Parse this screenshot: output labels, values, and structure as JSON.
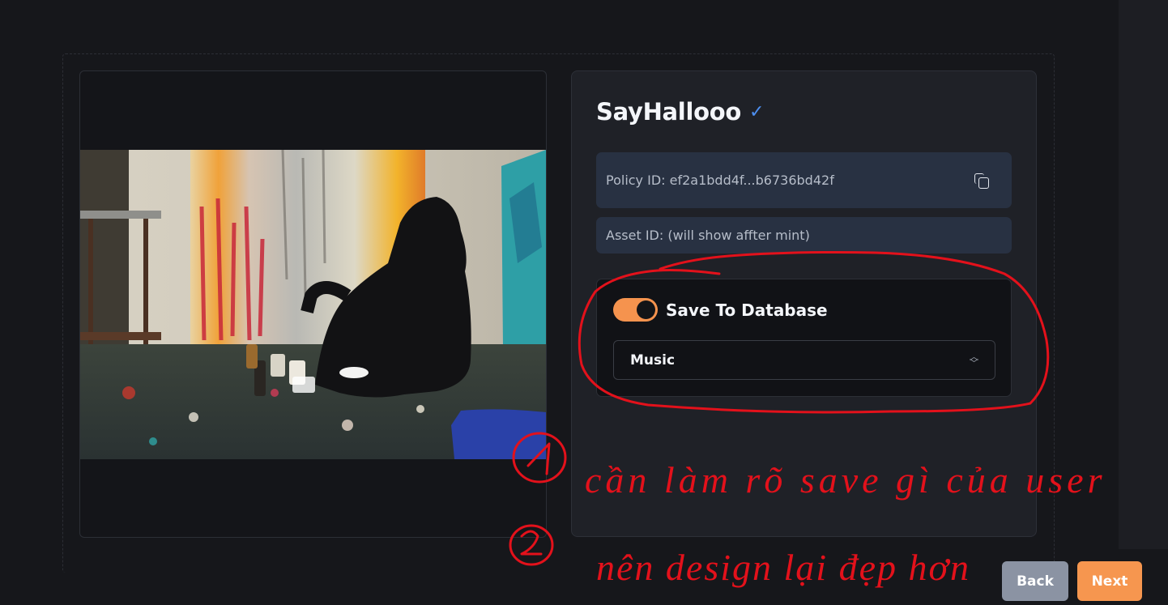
{
  "nft": {
    "title": "SayHallooo",
    "verified_icon": "check-mark-icon",
    "policy_id_text": "Policy ID: ef2a1bdd4f...b6736bd42f",
    "asset_id_text": "Asset ID: (will show affter mint)"
  },
  "save_panel": {
    "toggle_label": "Save To Database",
    "toggle_on": true,
    "category_selected": "Music"
  },
  "buttons": {
    "back": "Back",
    "next": "Next"
  },
  "annotation": {
    "note_1": "cần làm rõ save gì của user",
    "note_2": "nên design lại đẹp hơn"
  },
  "colors": {
    "accent": "#f6964f",
    "verified": "#4d8ff0",
    "back_button": "#8b93a3",
    "annotation_red": "#e3111b"
  }
}
